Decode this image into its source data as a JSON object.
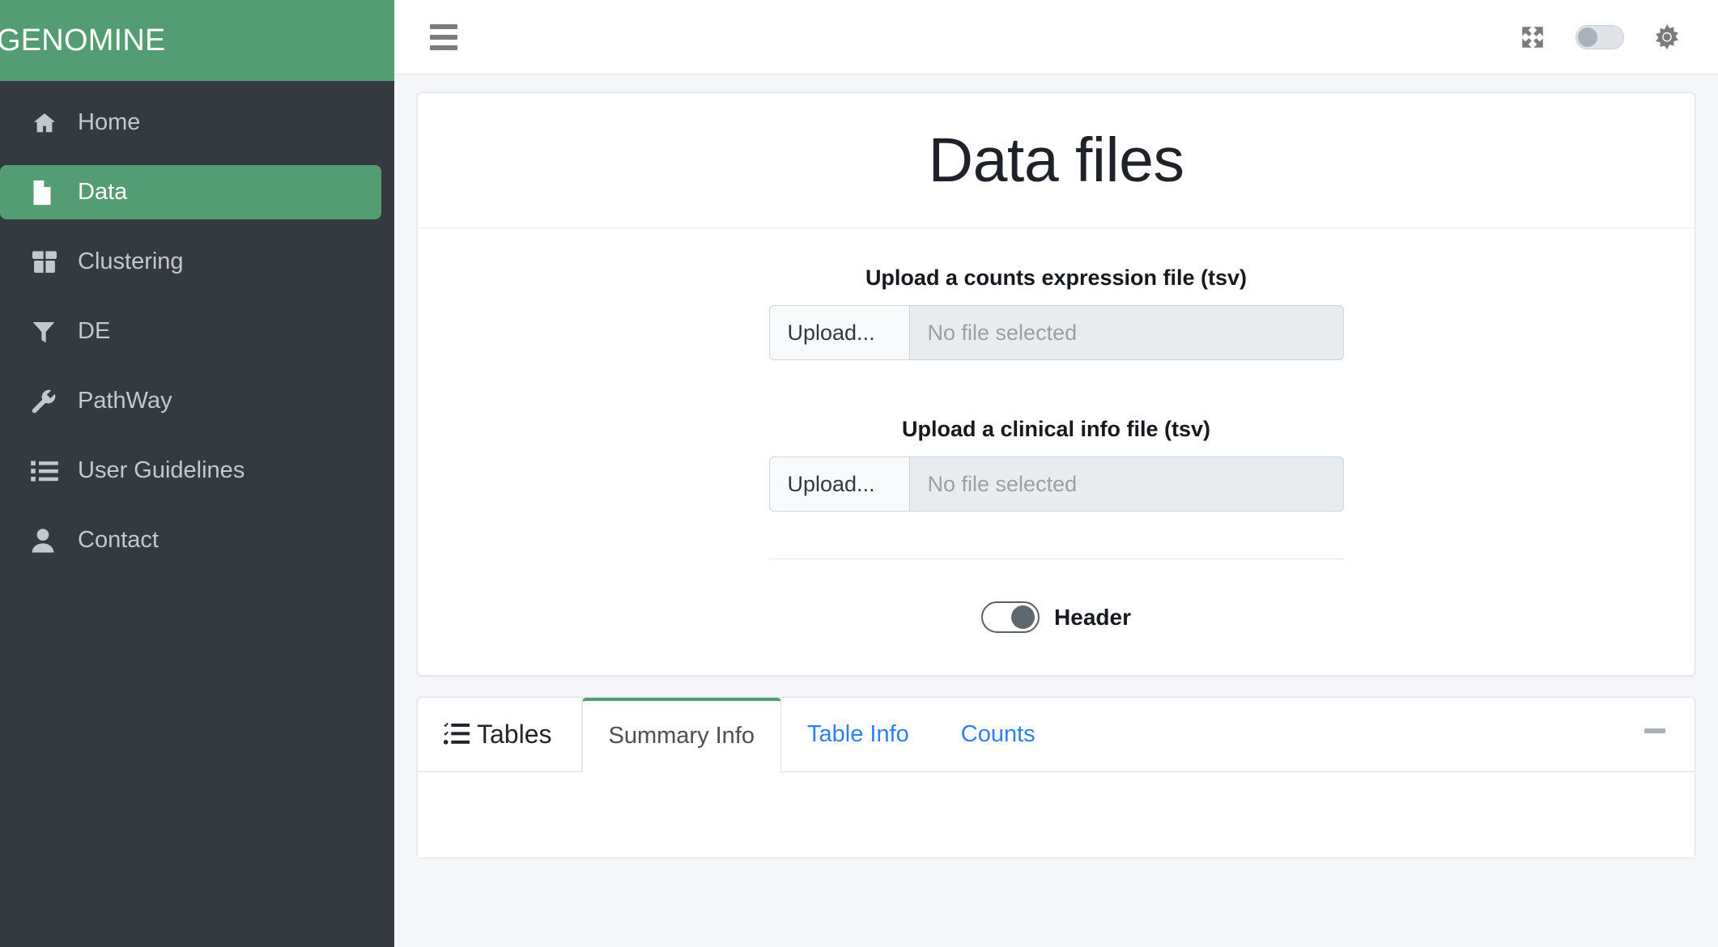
{
  "brand": {
    "name": "GENOMINE"
  },
  "sidebar": {
    "items": [
      {
        "label": "Home",
        "icon": "home-icon",
        "active": false
      },
      {
        "label": "Data",
        "icon": "file-icon",
        "active": true
      },
      {
        "label": "Clustering",
        "icon": "box-icon",
        "active": false
      },
      {
        "label": "DE",
        "icon": "filter-icon",
        "active": false
      },
      {
        "label": "PathWay",
        "icon": "wrench-icon",
        "active": false
      },
      {
        "label": "User Guidelines",
        "icon": "list-icon",
        "active": false
      },
      {
        "label": "Contact",
        "icon": "user-icon",
        "active": false
      }
    ]
  },
  "topbar": {
    "menu_icon": "hamburger-icon",
    "fullscreen_icon": "expand-arrows-icon",
    "theme_toggle": {
      "icon": "toggle-switch-icon",
      "state": "off"
    },
    "settings_icon": "gear-icon"
  },
  "main": {
    "title": "Data files",
    "counts_upload": {
      "label": "Upload a counts expression file (tsv)",
      "button": "Upload...",
      "placeholder": "No file selected"
    },
    "clinical_upload": {
      "label": "Upload a clinical info file (tsv)",
      "button": "Upload...",
      "placeholder": "No file selected"
    },
    "header_toggle": {
      "label": "Header",
      "state": "on"
    }
  },
  "tables_panel": {
    "title": "Tables",
    "title_icon": "tasks-list-icon",
    "collapse_icon": "minus-icon",
    "tabs": [
      {
        "label": "Summary Info",
        "active": true
      },
      {
        "label": "Table Info",
        "active": false
      },
      {
        "label": "Counts",
        "active": false
      }
    ]
  },
  "colors": {
    "brand_green": "#549c71",
    "sidebar_dark": "#343a40",
    "link_blue": "#2e80f2",
    "page_bg": "#f4f6f9"
  }
}
